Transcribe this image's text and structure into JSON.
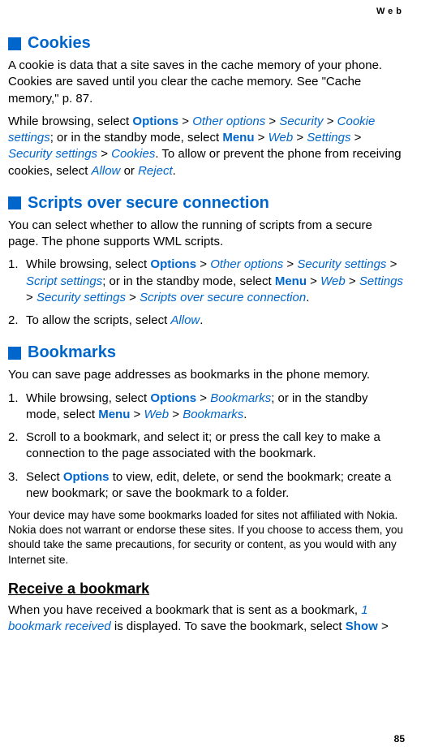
{
  "header": {
    "label": "Web"
  },
  "page_number": "85",
  "sections": {
    "cookies": {
      "title": "Cookies",
      "p1": {
        "pre": "A cookie is data that a site saves in the cache memory of your phone. Cookies are saved until you clear the cache memory. See \"Cache memory,\" p. 87."
      },
      "p2": {
        "t1": "While browsing, select ",
        "options": "Options",
        "gt1": " > ",
        "other_options": "Other options",
        "gt2": " > ",
        "security": "Security",
        "gt3": " > ",
        "cookie_settings": "Cookie settings",
        "t2": "; or in the standby mode, select ",
        "menu": "Menu",
        "gt4": " > ",
        "web": "Web",
        "gt5": " > ",
        "settings": "Settings",
        "gt6": " > ",
        "security_settings": "Security settings",
        "gt7": " > ",
        "cookies": "Cookies",
        "t3": ". To allow or prevent the phone from receiving cookies, select ",
        "allow": "Allow",
        "or": " or ",
        "reject": "Reject",
        "period": "."
      }
    },
    "scripts": {
      "title": "Scripts over secure connection",
      "p1": "You can select whether to allow the running of scripts from a secure page. The phone supports WML scripts.",
      "li1": {
        "t1": "While browsing, select ",
        "options": "Options",
        "gt1": " > ",
        "other_options": "Other options",
        "gt2": " > ",
        "security_settings": "Security settings",
        "gt3": " > ",
        "script_settings": "Script settings",
        "t2": "; or in the standby mode, select ",
        "menu": "Menu",
        "gt4": " > ",
        "web": "Web",
        "gt5": " > ",
        "settings": "Settings",
        "gt6": " > ",
        "security_settings2": "Security settings",
        "gt7": " > ",
        "scripts_over": "Scripts over secure connection",
        "period": "."
      },
      "li2": {
        "t1": "To allow the scripts, select ",
        "allow": "Allow",
        "period": "."
      }
    },
    "bookmarks": {
      "title": "Bookmarks",
      "p1": "You can save page addresses as bookmarks in the phone memory.",
      "li1": {
        "t1": "While browsing, select ",
        "options": "Options",
        "gt1": " > ",
        "bookmarks": "Bookmarks",
        "t2": "; or in the standby mode, select ",
        "menu": "Menu",
        "gt3": " > ",
        "web": "Web",
        "gt4": " > ",
        "bookmarks2": "Bookmarks",
        "period": "."
      },
      "li2": "Scroll to a bookmark, and select it; or press the call key to make a connection to the page associated with the bookmark.",
      "li3": {
        "t1": "Select ",
        "options": "Options",
        "t2": " to view, edit, delete, or send the bookmark; create a new bookmark; or save the bookmark to a folder."
      },
      "note": "Your device may have some bookmarks loaded for sites not affiliated with Nokia. Nokia does not warrant or endorse these sites. If you choose to access them, you should take the same precautions, for security or content, as you would with any Internet site.",
      "sub_title": "Receive a bookmark",
      "p2": {
        "t1": "When you have received a bookmark that is sent as a bookmark, ",
        "received": "1 bookmark received",
        "t2": " is displayed. To save the bookmark, select ",
        "show": "Show",
        "gt": " > "
      }
    }
  }
}
